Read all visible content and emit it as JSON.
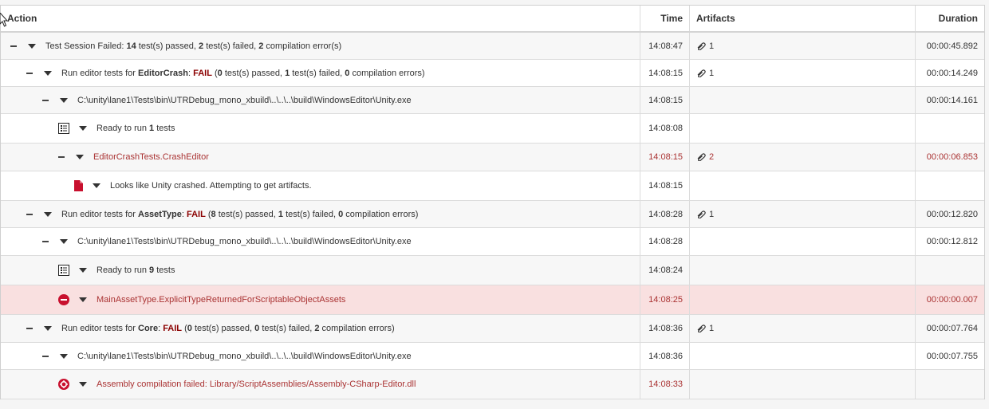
{
  "header": {
    "action": "Action",
    "time": "Time",
    "artifacts": "Artifacts",
    "duration": "Duration"
  },
  "rows": [
    {
      "segments": [
        "Test Session Failed: ",
        "14",
        " test(s) passed, ",
        "2",
        " test(s) failed, ",
        "2",
        " compilation error(s)"
      ],
      "time": "14:08:47",
      "artifacts": "1",
      "duration": "00:00:45.892"
    },
    {
      "segments": [
        "Run editor tests for ",
        "EditorCrash",
        ": ",
        "FAIL",
        " (",
        "0",
        " test(s) passed, ",
        "1",
        " test(s) failed, ",
        "0",
        " compilation errors)"
      ],
      "time": "14:08:15",
      "artifacts": "1",
      "duration": "00:00:14.249"
    },
    {
      "text": "C:\\unity\\lane1\\Tests\\bin\\UTRDebug_mono_xbuild\\..\\..\\..\\build\\WindowsEditor\\Unity.exe",
      "time": "14:08:15",
      "artifacts": "",
      "duration": "00:00:14.161"
    },
    {
      "segments": [
        "Ready to run ",
        "1",
        " tests"
      ],
      "time": "14:08:08",
      "artifacts": "",
      "duration": ""
    },
    {
      "text": "EditorCrashTests.CrashEditor",
      "time": "14:08:15",
      "artifacts": "2",
      "duration": "00:00:06.853"
    },
    {
      "text": "Looks like Unity crashed. Attempting to get artifacts.",
      "time": "14:08:15",
      "artifacts": "",
      "duration": ""
    },
    {
      "segments": [
        "Run editor tests for ",
        "AssetType",
        ": ",
        "FAIL",
        " (",
        "8",
        " test(s) passed, ",
        "1",
        " test(s) failed, ",
        "0",
        " compilation errors)"
      ],
      "time": "14:08:28",
      "artifacts": "1",
      "duration": "00:00:12.820"
    },
    {
      "text": "C:\\unity\\lane1\\Tests\\bin\\UTRDebug_mono_xbuild\\..\\..\\..\\build\\WindowsEditor\\Unity.exe",
      "time": "14:08:28",
      "artifacts": "",
      "duration": "00:00:12.812"
    },
    {
      "segments": [
        "Ready to run ",
        "9",
        " tests"
      ],
      "time": "14:08:24",
      "artifacts": "",
      "duration": ""
    },
    {
      "text": "MainAssetType.ExplicitTypeReturnedForScriptableObjectAssets",
      "time": "14:08:25",
      "artifacts": "",
      "duration": "00:00:00.007"
    },
    {
      "segments": [
        "Run editor tests for ",
        "Core",
        ": ",
        "FAIL",
        " (",
        "0",
        " test(s) passed, ",
        "0",
        " test(s) failed, ",
        "2",
        " compilation errors)"
      ],
      "time": "14:08:36",
      "artifacts": "1",
      "duration": "00:00:07.764"
    },
    {
      "text": "C:\\unity\\lane1\\Tests\\bin\\UTRDebug_mono_xbuild\\..\\..\\..\\build\\WindowsEditor\\Unity.exe",
      "time": "14:08:36",
      "artifacts": "",
      "duration": "00:00:07.755"
    },
    {
      "text": "Assembly compilation failed: Library/ScriptAssemblies/Assembly-CSharp-Editor.dll",
      "time": "14:08:33",
      "artifacts": "",
      "duration": ""
    }
  ],
  "icons": {
    "collapse": "minus-icon",
    "expand": "caret-down-icon",
    "log": "log-list-icon",
    "crash": "red-file-icon",
    "failed": "red-stop-icon",
    "compile_error": "red-gear-icon",
    "artifact": "paperclip-icon"
  },
  "colors": {
    "error_text": "#a33333",
    "fail_label": "#8b0000",
    "error_row": "#f9e0e0"
  }
}
